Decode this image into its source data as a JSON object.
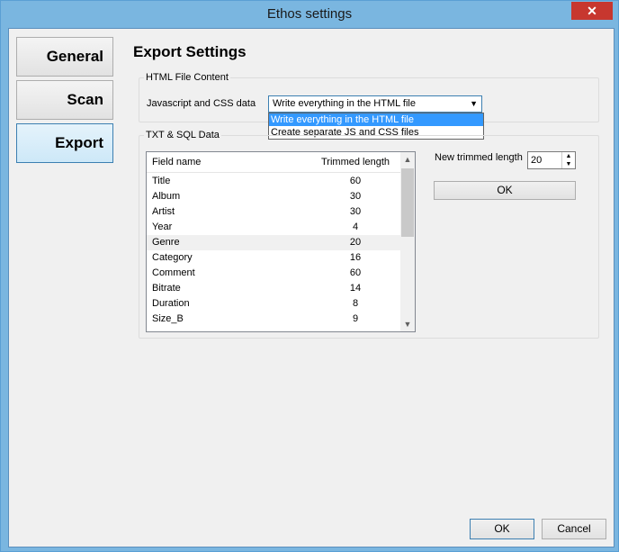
{
  "window": {
    "title": "Ethos settings",
    "close_glyph": "✕"
  },
  "nav": [
    {
      "label": "General",
      "selected": false
    },
    {
      "label": "Scan",
      "selected": false
    },
    {
      "label": "Export",
      "selected": true
    }
  ],
  "main": {
    "heading": "Export Settings",
    "html_group": {
      "title": "HTML File Content",
      "field_label": "Javascript and CSS data",
      "selected": "Write everything in the HTML file",
      "options": [
        "Write everything in the HTML file",
        "Create separate JS and CSS files"
      ]
    },
    "txt_group": {
      "title": "TXT & SQL Data",
      "columns": [
        "Field name",
        "Trimmed length"
      ],
      "rows": [
        [
          "Title",
          "60"
        ],
        [
          "Album",
          "30"
        ],
        [
          "Artist",
          "30"
        ],
        [
          "Year",
          "4"
        ],
        [
          "Genre",
          "20"
        ],
        [
          "Category",
          "16"
        ],
        [
          "Comment",
          "60"
        ],
        [
          "Bitrate",
          "14"
        ],
        [
          "Duration",
          "8"
        ],
        [
          "Size_B",
          "9"
        ]
      ],
      "selected_row": 4,
      "new_length_label": "New trimmed length",
      "new_length_value": "20",
      "ok_label": "OK"
    }
  },
  "footer": {
    "ok_label": "OK",
    "cancel_label": "Cancel"
  }
}
